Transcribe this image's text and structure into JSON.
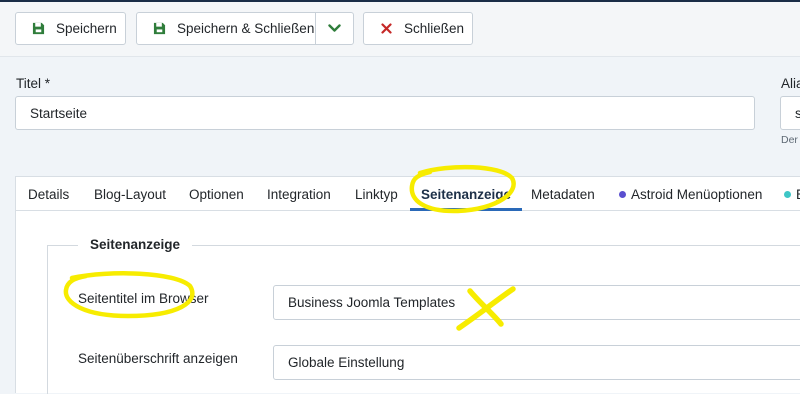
{
  "toolbar": {
    "save_label": "Speichern",
    "save_close_label": "Speichern & Schließen",
    "close_label": "Schließen"
  },
  "title_field": {
    "label": "Titel *",
    "value": "Startseite"
  },
  "alias_field": {
    "label_partial": "Alia",
    "value_partial": "s",
    "helper_partial": "Der"
  },
  "tabs": [
    {
      "label": "Details"
    },
    {
      "label": "Blog-Layout"
    },
    {
      "label": "Optionen"
    },
    {
      "label": "Integration"
    },
    {
      "label": "Linktyp"
    },
    {
      "label": "Seitenanzeige",
      "active": true
    },
    {
      "label": "Metadaten"
    },
    {
      "label": "Astroid Menüoptionen",
      "dot_color": "#5a4fcf"
    },
    {
      "label": "E",
      "dot_color": "#3ec6c6"
    }
  ],
  "section": {
    "legend": "Seitenanzeige",
    "fields": [
      {
        "label": "Seitentitel im Browser",
        "value": "Business Joomla Templates"
      },
      {
        "label": "Seitenüberschrift anzeigen",
        "value": "Globale Einstellung"
      }
    ]
  },
  "colors": {
    "save_icon": "#2f7d3b",
    "close_icon": "#c52827",
    "highlight": "#f7ec00",
    "tab_active": "#2a69b8"
  }
}
